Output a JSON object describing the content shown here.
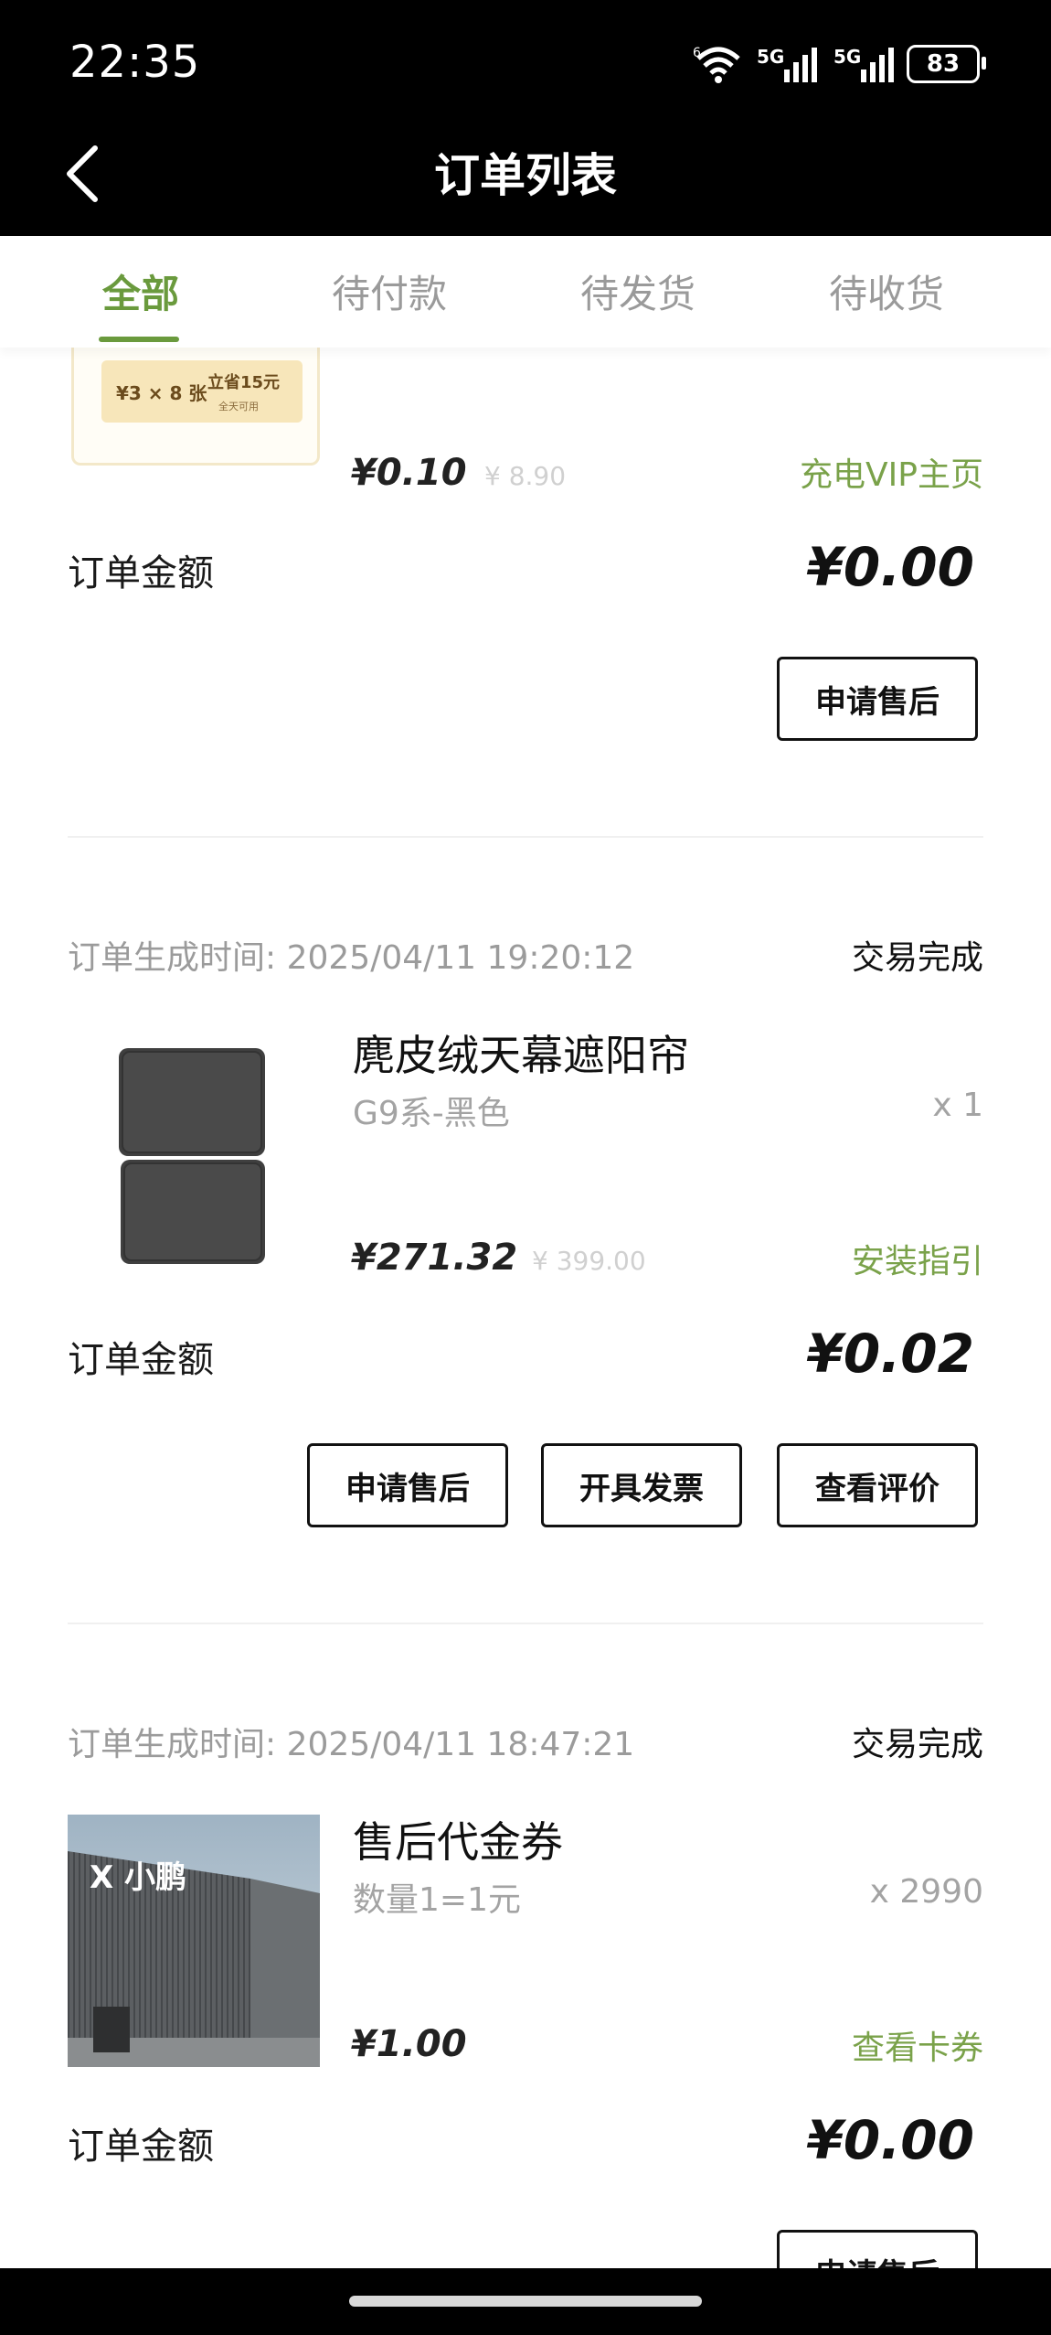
{
  "status_bar": {
    "time": "22:35",
    "wifi_label": "6",
    "sim1_label": "5G",
    "sim2_label": "5G",
    "battery": "83"
  },
  "header": {
    "title": "订单列表"
  },
  "tabs": [
    {
      "label": "全部",
      "active": true
    },
    {
      "label": "待付款",
      "active": false
    },
    {
      "label": "待发货",
      "active": false
    },
    {
      "label": "待收货",
      "active": false
    }
  ],
  "orders": [
    {
      "coupon_image": {
        "line1": "¥3 × 8 张",
        "line2": "立省15元",
        "line3": "全天可用"
      },
      "price": "¥0.10",
      "original_price": "¥ 8.90",
      "action_link": "充电VIP主页",
      "amount_label": "订单金额",
      "amount": "¥0.00",
      "buttons": [
        "申请售后"
      ]
    },
    {
      "time_label": "订单生成时间: 2025/04/11 19:20:12",
      "status": "交易完成",
      "product_name": "麂皮绒天幕遮阳帘",
      "spec": "G9系-黑色",
      "quantity": "x 1",
      "price": "¥271.32",
      "original_price": "¥ 399.00",
      "action_link": "安装指引",
      "amount_label": "订单金额",
      "amount": "¥0.02",
      "buttons": [
        "申请售后",
        "开具发票",
        "查看评价"
      ]
    },
    {
      "time_label": "订单生成时间: 2025/04/11 18:47:21",
      "status": "交易完成",
      "product_name": "售后代金券",
      "spec": "数量1=1元",
      "quantity": "x 2990",
      "price": "¥1.00",
      "action_link": "查看卡券",
      "amount_label": "订单金额",
      "amount": "¥0.00",
      "buttons": [
        "申请售后"
      ],
      "image_sign": "X 小鹏"
    }
  ],
  "colors": {
    "accent_green": "#6a9a3d",
    "link_green": "#7aa24a",
    "header_bg": "#000000"
  }
}
